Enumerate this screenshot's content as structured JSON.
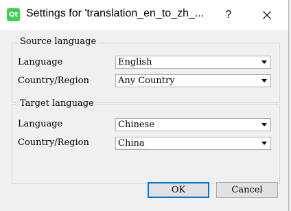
{
  "window": {
    "app_icon_text": "Qt",
    "title": "Settings for 'translation_en_to_zh_...",
    "help_label": "?",
    "close_icon": "close-icon"
  },
  "source": {
    "group_title": "Source language",
    "language_label": "Language",
    "language_value": "English",
    "region_label": "Country/Region",
    "region_value": "Any Country"
  },
  "target": {
    "group_title": "Target language",
    "language_label": "Language",
    "language_value": "Chinese",
    "region_label": "Country/Region",
    "region_value": "China"
  },
  "buttons": {
    "ok_label": "OK",
    "cancel_label": "Cancel"
  },
  "colors": {
    "accent": "#0078d7",
    "qt_green": "#41cd52"
  }
}
